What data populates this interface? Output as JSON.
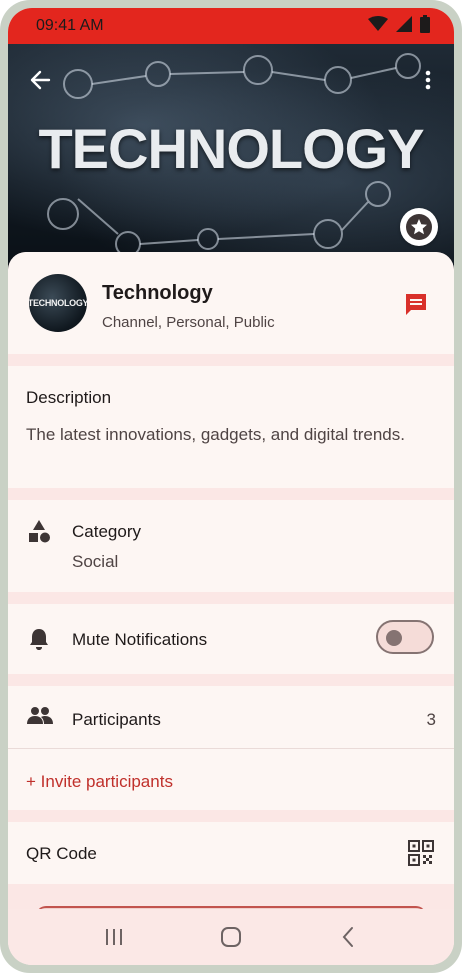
{
  "status_bar": {
    "time": "09:41 AM",
    "icons": [
      "wifi-icon",
      "signal-icon",
      "battery-icon"
    ]
  },
  "hero": {
    "banner_text": "TECHNOLOGY",
    "back_icon": "arrow-back-icon",
    "more_icon": "more-vert-icon",
    "favorite_icon": "star-icon"
  },
  "channel": {
    "avatar_text": "TECHNOLOGY",
    "name": "Technology",
    "meta": "Channel, Personal, Public",
    "chat_icon": "chat-icon"
  },
  "description": {
    "title": "Description",
    "text": "The latest innovations, gadgets, and digital trends."
  },
  "category": {
    "title": "Category",
    "value": "Social",
    "icon": "category-shapes-icon"
  },
  "mute": {
    "title": "Mute Notifications",
    "enabled": false,
    "icon": "bell-icon"
  },
  "participants": {
    "title": "Participants",
    "count": "3",
    "invite_label": "+ Invite participants",
    "icon": "people-icon"
  },
  "qr": {
    "title": "QR Code",
    "icon": "qr-code-icon"
  },
  "nav": {
    "items": [
      "recents-icon",
      "home-icon",
      "back-icon"
    ]
  },
  "colors": {
    "accent": "#e3261e",
    "link": "#c0302b",
    "surface": "#fdf6f3",
    "background": "#fbe7e5"
  }
}
